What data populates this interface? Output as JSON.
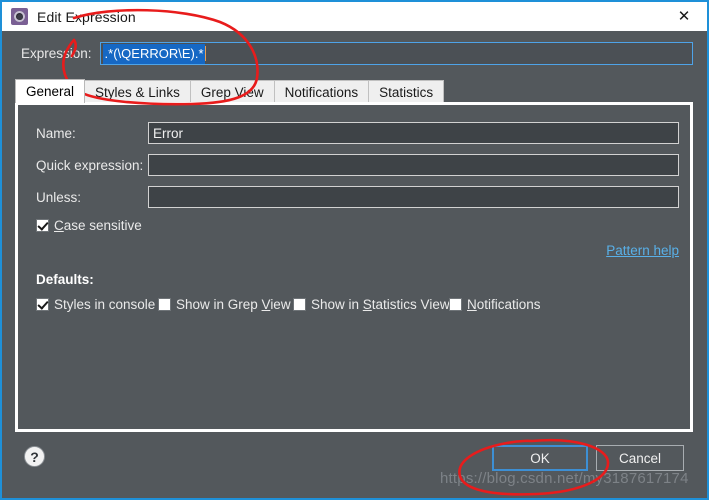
{
  "window": {
    "title": "Edit Expression",
    "icon": "gear-icon",
    "close_label": "✕"
  },
  "expression": {
    "label": "Expression:",
    "value": ".*(\\QERROR\\E).*",
    "selected": true
  },
  "tabs": [
    {
      "label": "General",
      "active": true
    },
    {
      "label": "Styles & Links",
      "active": false
    },
    {
      "label": "Grep View",
      "active": false
    },
    {
      "label": "Notifications",
      "active": false
    },
    {
      "label": "Statistics",
      "active": false
    }
  ],
  "general": {
    "fields": [
      {
        "label": "Name:",
        "value": "Error",
        "placeholder": ""
      },
      {
        "label": "Quick expression:",
        "value": "",
        "placeholder": ""
      },
      {
        "label": "Unless:",
        "value": "",
        "placeholder": ""
      }
    ],
    "case_sensitive": {
      "label": "Case sensitive",
      "checked": true
    },
    "pattern_help": "Pattern help",
    "defaults_title": "Defaults:",
    "defaults": [
      {
        "label": "Styles in console",
        "checked": true
      },
      {
        "label": "Show in Grep View",
        "checked": false
      },
      {
        "label": "Show in Statistics View",
        "checked": false
      },
      {
        "label": "Notifications",
        "checked": false
      }
    ]
  },
  "footer": {
    "help_label": "?",
    "ok_label": "OK",
    "cancel_label": "Cancel"
  },
  "watermark": "https://blog.csdn.net/my3187617174",
  "colors": {
    "accent": "#1e90d8",
    "panel_bg": "#53585c",
    "input_bg": "#3e4347",
    "selection": "#1668c4",
    "link": "#59b0e8",
    "annotation": "#e81c1c"
  }
}
